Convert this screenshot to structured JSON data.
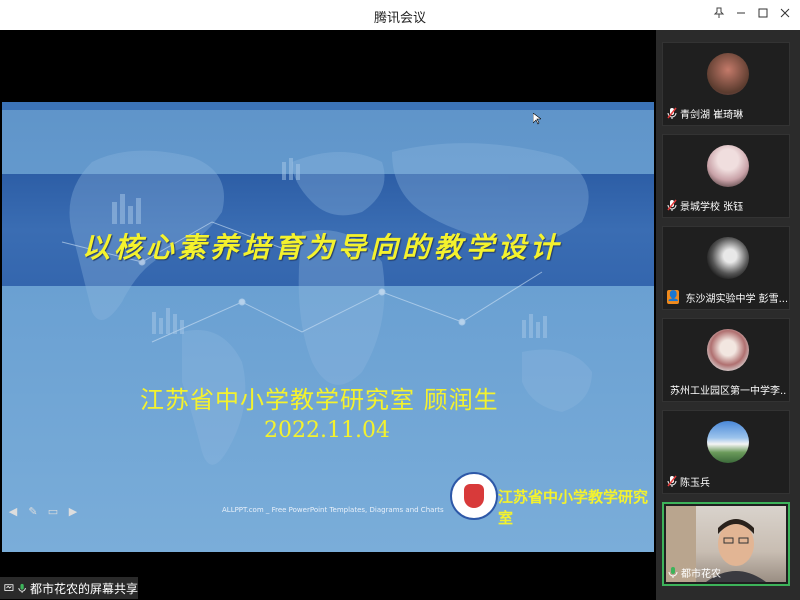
{
  "window": {
    "title": "腾讯会议"
  },
  "slide": {
    "title": "以核心素养培育为导向的教学设计",
    "subtitle": "江苏省中小学教学研究室  顾润生",
    "date": "2022.11.04",
    "footer": "ALLPPT.com _ Free PowerPoint Templates, Diagrams and Charts",
    "logo_text": "江苏省中小学教学研究室"
  },
  "share": {
    "label": "都市花农的屏幕共享"
  },
  "participants": [
    {
      "name": "青剑湖 崔琦琳",
      "mic": "muted"
    },
    {
      "name": "景城学校  张钰",
      "mic": "muted"
    },
    {
      "name": "东沙湖实验中学 彭雪...",
      "mic": "on"
    },
    {
      "name": "苏州工业园区第一中学李...",
      "mic": "muted"
    },
    {
      "name": "陈玉兵",
      "mic": "muted"
    },
    {
      "name": "都市花农",
      "mic": "on",
      "active": true
    }
  ],
  "colors": {
    "slide_text": "#f4f22d",
    "active_border": "#3db35a"
  }
}
